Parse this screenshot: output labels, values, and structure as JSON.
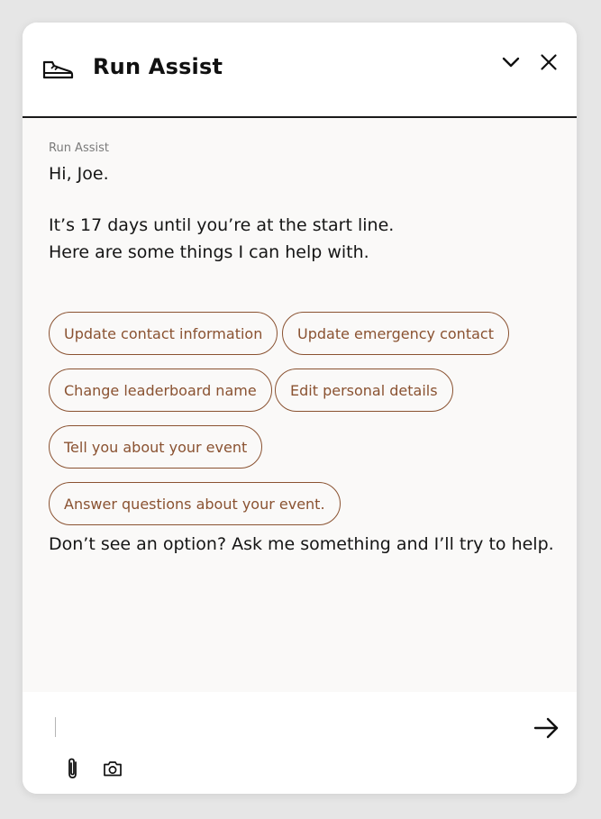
{
  "header": {
    "title": "Run Assist",
    "logo_icon": "running-shoe-icon",
    "minimize_icon": "chevron-down-icon",
    "close_icon": "close-icon"
  },
  "conversation": {
    "sender": "Run Assist",
    "greeting": "Hi, Joe.",
    "intro_line_1": "It’s 17 days until you’re at the start line.",
    "intro_line_2": "Here are some things I can help with.",
    "options": [
      "Update contact information",
      "Update emergency contact",
      "Change leaderboard name",
      "Edit personal details",
      "Tell you about your event",
      "Answer questions about your event."
    ],
    "fallback": "Don’t see an option? Ask me something and I’ll try to help."
  },
  "composer": {
    "value": "",
    "placeholder": "",
    "send_icon": "arrow-right-icon",
    "attach_icon": "paperclip-icon",
    "camera_icon": "camera-icon"
  },
  "colors": {
    "accent": "#8a5231",
    "panel_background": "#faf9f8",
    "header_background": "#ffffff",
    "page_background": "#e6e6e6",
    "text": "#151515"
  }
}
